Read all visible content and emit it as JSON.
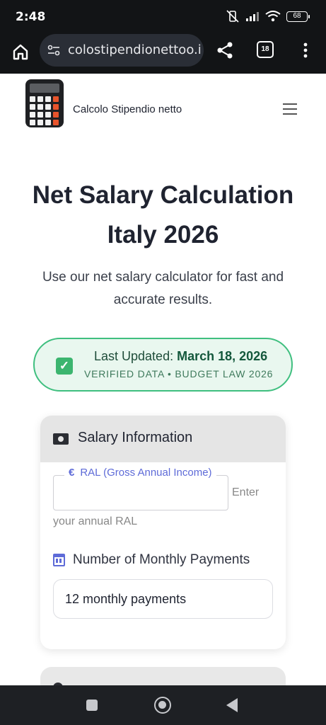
{
  "status_bar": {
    "time": "2:48",
    "battery": "68"
  },
  "browser": {
    "url": "colostipendionettoo.it",
    "tab_count": "18"
  },
  "header": {
    "site_name": "Calcolo Stipendio netto"
  },
  "hero": {
    "title_line1": "Net Salary Calculation",
    "title_line2": "Italy 2026",
    "subtitle": "Use our net salary calculator for fast and accurate results."
  },
  "update_badge": {
    "label": "Last Updated:",
    "date": "March 18, 2026",
    "note": "VERIFIED DATA • BUDGET LAW 2026"
  },
  "salary_card": {
    "title": "Salary Information",
    "ral_label": "RAL (Gross Annual Income)",
    "ral_value": "",
    "ral_help_part1": "Enter",
    "ral_help_part2": "your annual RAL",
    "payments_label": "Number of Monthly Payments",
    "payments_value": "12 monthly payments"
  }
}
